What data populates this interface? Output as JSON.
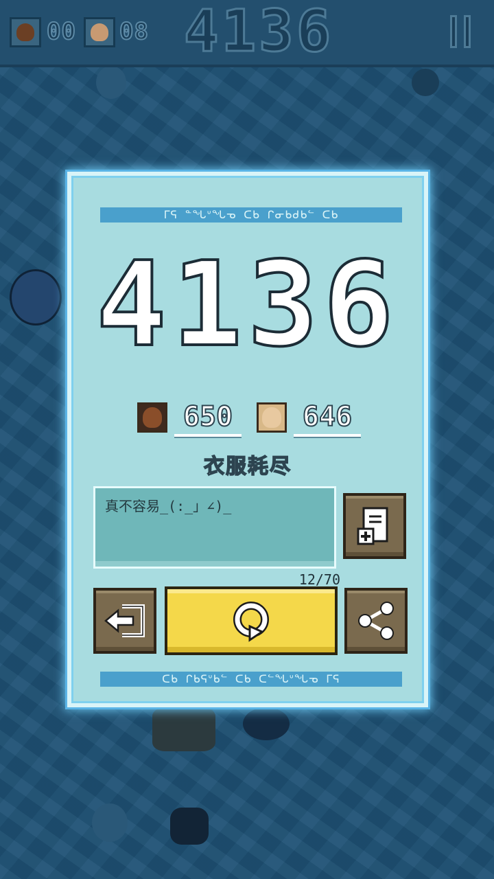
{
  "hud": {
    "player1_count": "00",
    "player2_count": "08",
    "score": "4136"
  },
  "result": {
    "score": "4136",
    "player1_score": "650",
    "player2_score": "646",
    "status": "衣服耗尽",
    "comment": "真不容易_(:_」∠)_",
    "char_count": "12/70",
    "rune_top": "ᒥᕋ ᓐᖓᐡᖓᓀ ᑕᑲ ᒋᓂᑲᑯᑲᓪ ᑕᑲ",
    "rune_bottom": "ᑕᑲ ᒋᑲᕋᐡᑲᓪ ᑕᑲ ᑕᓪᖓᐡᖓᓀ ᒥᕋ"
  },
  "colors": {
    "card_bg": "#a8dce0",
    "frame_glow": "#6cc8f2",
    "primary_button": "#f4d84a",
    "secondary_button": "#7a6a4e"
  },
  "icons": {
    "add_note": "add-note-icon",
    "exit": "exit-icon",
    "restart": "restart-icon",
    "share": "share-icon",
    "pause": "pause-icon"
  }
}
